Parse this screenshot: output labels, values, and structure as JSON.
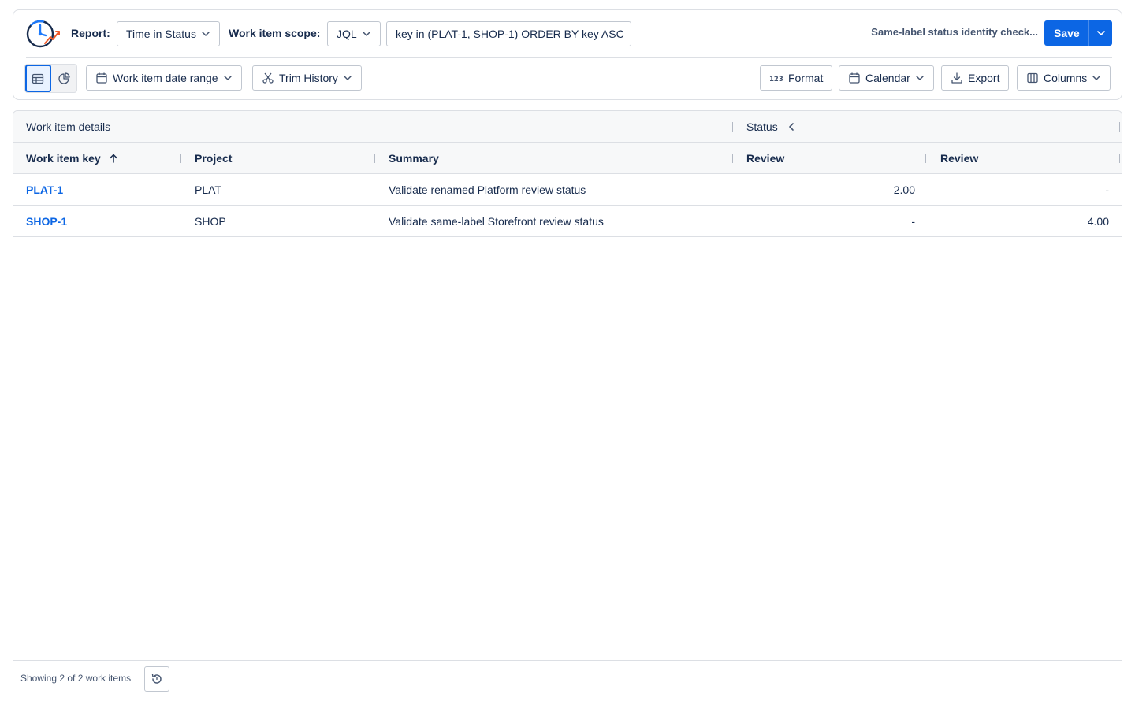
{
  "toolbar": {
    "report_label": "Report:",
    "report_value": "Time in Status",
    "scope_label": "Work item scope:",
    "scope_type": "JQL",
    "jql_value": "key in (PLAT-1, SHOP-1) ORDER BY key ASC",
    "report_name": "Same-label status identity check...",
    "save_label": "Save",
    "date_range_label": "Work item date range",
    "trim_history_label": "Trim History",
    "format_label": "Format",
    "calendar_label": "Calendar",
    "export_label": "Export",
    "columns_label": "Columns"
  },
  "table": {
    "group_headers": {
      "details": "Work item details",
      "status": "Status"
    },
    "columns": {
      "key": "Work item key",
      "project": "Project",
      "summary": "Summary",
      "review1": "Review",
      "review2": "Review"
    },
    "rows": [
      {
        "key": "PLAT-1",
        "project": "PLAT",
        "summary": "Validate renamed Platform review status",
        "review1": "2.00",
        "review2": "-"
      },
      {
        "key": "SHOP-1",
        "project": "SHOP",
        "summary": "Validate same-label Storefront review status",
        "review1": "-",
        "review2": "4.00"
      }
    ]
  },
  "footer": {
    "showing_text": "Showing 2 of 2 work items"
  },
  "colors": {
    "primary": "#0c66e4",
    "text": "#172b4d",
    "border": "#dcdfe4",
    "header_bg": "#f7f8f9"
  }
}
